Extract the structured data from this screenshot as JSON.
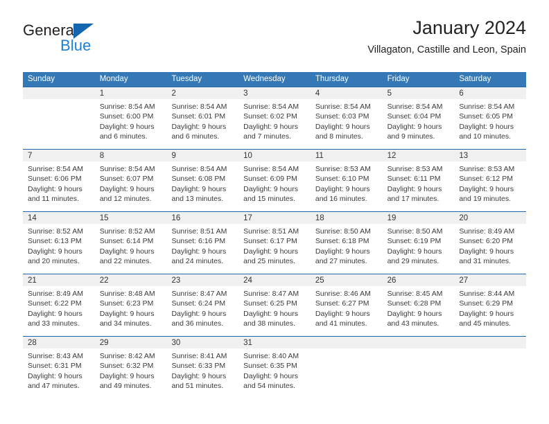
{
  "brand": {
    "name_part1": "General",
    "name_part2": "Blue",
    "logo_icon": "blue-triangle-logo"
  },
  "header": {
    "title": "January 2024",
    "subtitle": "Villagaton, Castille and Leon, Spain"
  },
  "colors": {
    "header_blue": "#3478b5",
    "row_border_blue": "#2166ac",
    "day_number_band": "#f0f0f0",
    "brand_blue": "#1b7fd4",
    "text": "#3a3a3a"
  },
  "weekdays": [
    "Sunday",
    "Monday",
    "Tuesday",
    "Wednesday",
    "Thursday",
    "Friday",
    "Saturday"
  ],
  "weeks": [
    [
      {
        "day": "",
        "lines": []
      },
      {
        "day": "1",
        "lines": [
          "Sunrise: 8:54 AM",
          "Sunset: 6:00 PM",
          "Daylight: 9 hours",
          "and 6 minutes."
        ]
      },
      {
        "day": "2",
        "lines": [
          "Sunrise: 8:54 AM",
          "Sunset: 6:01 PM",
          "Daylight: 9 hours",
          "and 6 minutes."
        ]
      },
      {
        "day": "3",
        "lines": [
          "Sunrise: 8:54 AM",
          "Sunset: 6:02 PM",
          "Daylight: 9 hours",
          "and 7 minutes."
        ]
      },
      {
        "day": "4",
        "lines": [
          "Sunrise: 8:54 AM",
          "Sunset: 6:03 PM",
          "Daylight: 9 hours",
          "and 8 minutes."
        ]
      },
      {
        "day": "5",
        "lines": [
          "Sunrise: 8:54 AM",
          "Sunset: 6:04 PM",
          "Daylight: 9 hours",
          "and 9 minutes."
        ]
      },
      {
        "day": "6",
        "lines": [
          "Sunrise: 8:54 AM",
          "Sunset: 6:05 PM",
          "Daylight: 9 hours",
          "and 10 minutes."
        ]
      }
    ],
    [
      {
        "day": "7",
        "lines": [
          "Sunrise: 8:54 AM",
          "Sunset: 6:06 PM",
          "Daylight: 9 hours",
          "and 11 minutes."
        ]
      },
      {
        "day": "8",
        "lines": [
          "Sunrise: 8:54 AM",
          "Sunset: 6:07 PM",
          "Daylight: 9 hours",
          "and 12 minutes."
        ]
      },
      {
        "day": "9",
        "lines": [
          "Sunrise: 8:54 AM",
          "Sunset: 6:08 PM",
          "Daylight: 9 hours",
          "and 13 minutes."
        ]
      },
      {
        "day": "10",
        "lines": [
          "Sunrise: 8:54 AM",
          "Sunset: 6:09 PM",
          "Daylight: 9 hours",
          "and 15 minutes."
        ]
      },
      {
        "day": "11",
        "lines": [
          "Sunrise: 8:53 AM",
          "Sunset: 6:10 PM",
          "Daylight: 9 hours",
          "and 16 minutes."
        ]
      },
      {
        "day": "12",
        "lines": [
          "Sunrise: 8:53 AM",
          "Sunset: 6:11 PM",
          "Daylight: 9 hours",
          "and 17 minutes."
        ]
      },
      {
        "day": "13",
        "lines": [
          "Sunrise: 8:53 AM",
          "Sunset: 6:12 PM",
          "Daylight: 9 hours",
          "and 19 minutes."
        ]
      }
    ],
    [
      {
        "day": "14",
        "lines": [
          "Sunrise: 8:52 AM",
          "Sunset: 6:13 PM",
          "Daylight: 9 hours",
          "and 20 minutes."
        ]
      },
      {
        "day": "15",
        "lines": [
          "Sunrise: 8:52 AM",
          "Sunset: 6:14 PM",
          "Daylight: 9 hours",
          "and 22 minutes."
        ]
      },
      {
        "day": "16",
        "lines": [
          "Sunrise: 8:51 AM",
          "Sunset: 6:16 PM",
          "Daylight: 9 hours",
          "and 24 minutes."
        ]
      },
      {
        "day": "17",
        "lines": [
          "Sunrise: 8:51 AM",
          "Sunset: 6:17 PM",
          "Daylight: 9 hours",
          "and 25 minutes."
        ]
      },
      {
        "day": "18",
        "lines": [
          "Sunrise: 8:50 AM",
          "Sunset: 6:18 PM",
          "Daylight: 9 hours",
          "and 27 minutes."
        ]
      },
      {
        "day": "19",
        "lines": [
          "Sunrise: 8:50 AM",
          "Sunset: 6:19 PM",
          "Daylight: 9 hours",
          "and 29 minutes."
        ]
      },
      {
        "day": "20",
        "lines": [
          "Sunrise: 8:49 AM",
          "Sunset: 6:20 PM",
          "Daylight: 9 hours",
          "and 31 minutes."
        ]
      }
    ],
    [
      {
        "day": "21",
        "lines": [
          "Sunrise: 8:49 AM",
          "Sunset: 6:22 PM",
          "Daylight: 9 hours",
          "and 33 minutes."
        ]
      },
      {
        "day": "22",
        "lines": [
          "Sunrise: 8:48 AM",
          "Sunset: 6:23 PM",
          "Daylight: 9 hours",
          "and 34 minutes."
        ]
      },
      {
        "day": "23",
        "lines": [
          "Sunrise: 8:47 AM",
          "Sunset: 6:24 PM",
          "Daylight: 9 hours",
          "and 36 minutes."
        ]
      },
      {
        "day": "24",
        "lines": [
          "Sunrise: 8:47 AM",
          "Sunset: 6:25 PM",
          "Daylight: 9 hours",
          "and 38 minutes."
        ]
      },
      {
        "day": "25",
        "lines": [
          "Sunrise: 8:46 AM",
          "Sunset: 6:27 PM",
          "Daylight: 9 hours",
          "and 41 minutes."
        ]
      },
      {
        "day": "26",
        "lines": [
          "Sunrise: 8:45 AM",
          "Sunset: 6:28 PM",
          "Daylight: 9 hours",
          "and 43 minutes."
        ]
      },
      {
        "day": "27",
        "lines": [
          "Sunrise: 8:44 AM",
          "Sunset: 6:29 PM",
          "Daylight: 9 hours",
          "and 45 minutes."
        ]
      }
    ],
    [
      {
        "day": "28",
        "lines": [
          "Sunrise: 8:43 AM",
          "Sunset: 6:31 PM",
          "Daylight: 9 hours",
          "and 47 minutes."
        ]
      },
      {
        "day": "29",
        "lines": [
          "Sunrise: 8:42 AM",
          "Sunset: 6:32 PM",
          "Daylight: 9 hours",
          "and 49 minutes."
        ]
      },
      {
        "day": "30",
        "lines": [
          "Sunrise: 8:41 AM",
          "Sunset: 6:33 PM",
          "Daylight: 9 hours",
          "and 51 minutes."
        ]
      },
      {
        "day": "31",
        "lines": [
          "Sunrise: 8:40 AM",
          "Sunset: 6:35 PM",
          "Daylight: 9 hours",
          "and 54 minutes."
        ]
      },
      {
        "day": "",
        "lines": []
      },
      {
        "day": "",
        "lines": []
      },
      {
        "day": "",
        "lines": []
      }
    ]
  ]
}
